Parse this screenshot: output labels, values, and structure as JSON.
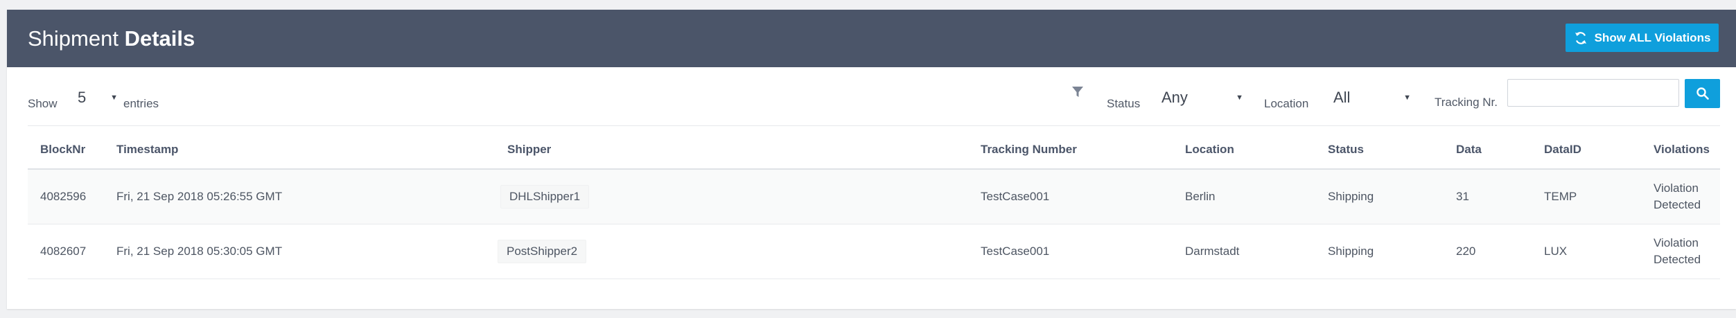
{
  "header": {
    "title_light": "Shipment",
    "title_bold": "Details",
    "violations_button": "Show ALL Violations",
    "violations_icon": "refresh-icon"
  },
  "toolbar": {
    "show_label": "Show",
    "entries_value": "5",
    "entries_label": "entries",
    "filter_icon": "filter-icon",
    "status_label": "Status",
    "status_value": "Any",
    "location_label": "Location",
    "location_value": "All",
    "tracking_label": "Tracking Nr.",
    "tracking_value": "",
    "search_icon": "search-icon"
  },
  "table": {
    "columns": [
      "BlockNr",
      "Timestamp",
      "Shipper",
      "Tracking Number",
      "Location",
      "Status",
      "Data",
      "DataID",
      "Violations"
    ],
    "rows": [
      {
        "block": "4082596",
        "timestamp": "Fri, 21 Sep 2018 05:26:55 GMT",
        "shipper": "DHLShipper1",
        "tracking": "TestCase001",
        "location": "Berlin",
        "status": "Shipping",
        "data": "31",
        "dataid": "TEMP",
        "violations": "Violation Detected"
      },
      {
        "block": "4082607",
        "timestamp": "Fri, 21 Sep 2018 05:30:05 GMT",
        "shipper": "PostShipper2",
        "tracking": "TestCase001",
        "location": "Darmstadt",
        "status": "Shipping",
        "data": "220",
        "dataid": "LUX",
        "violations": "Violation Detected"
      }
    ]
  },
  "colors": {
    "header_bg": "#4b5569",
    "accent": "#0f9fdc"
  }
}
